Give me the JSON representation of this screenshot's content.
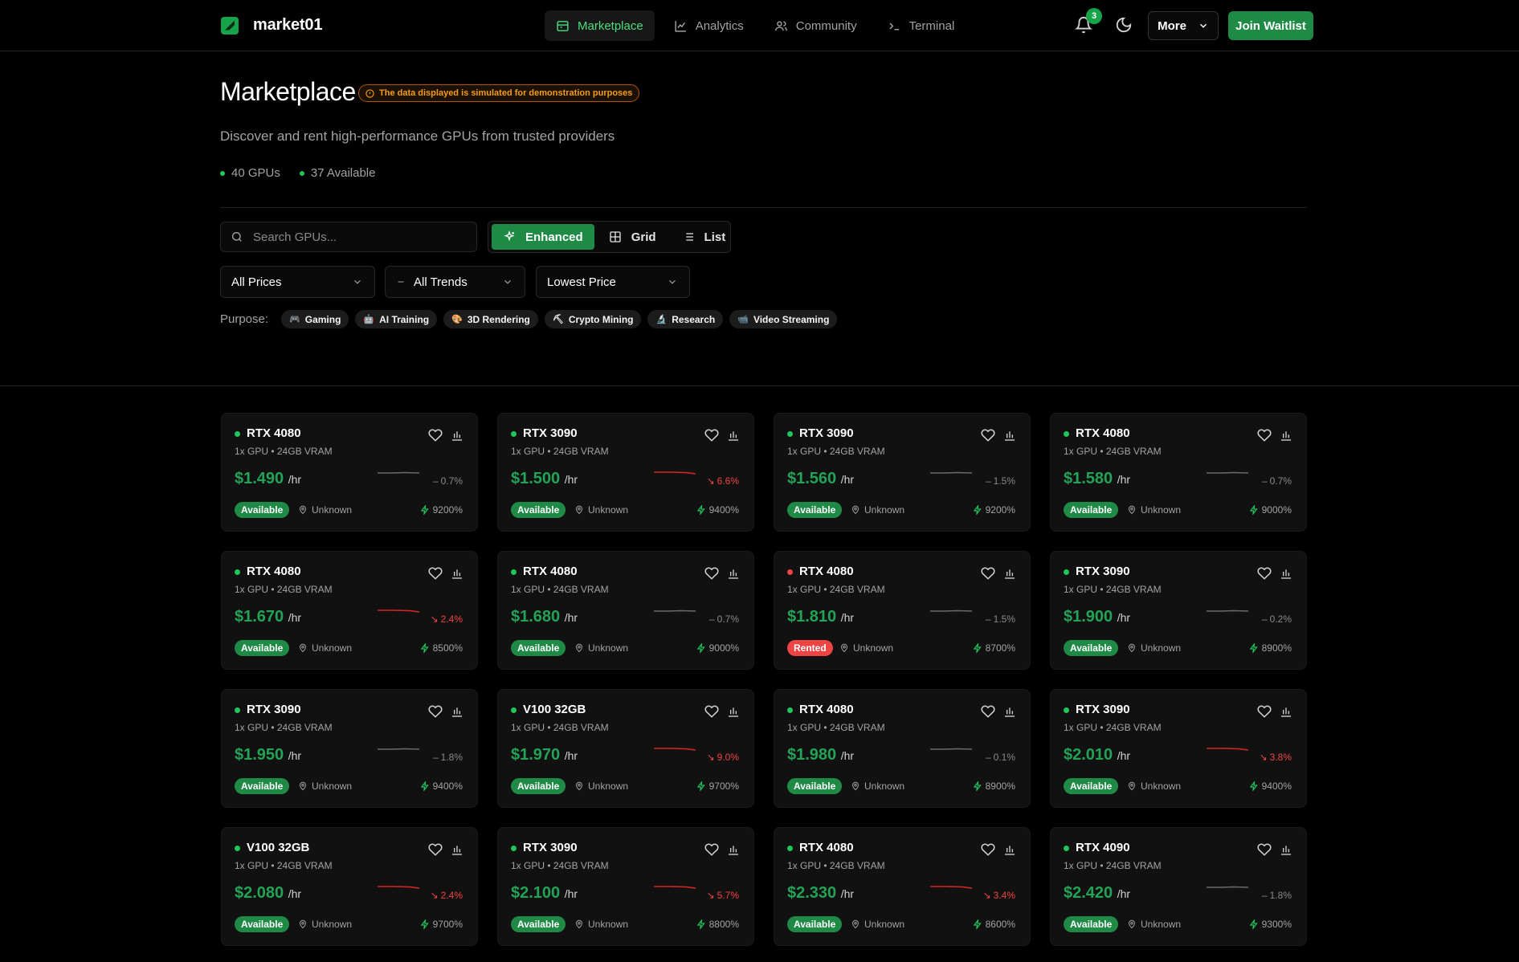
{
  "app": {
    "brand": "market01",
    "notification_count": "3",
    "more_label": "More",
    "join_label": "Join Waitlist"
  },
  "nav": [
    {
      "label": "Marketplace",
      "icon": "store-icon",
      "active": true
    },
    {
      "label": "Analytics",
      "icon": "chart-line-icon",
      "active": false
    },
    {
      "label": "Community",
      "icon": "users-icon",
      "active": false
    },
    {
      "label": "Terminal",
      "icon": "terminal-icon",
      "active": false
    }
  ],
  "hero": {
    "title": "Marketplace",
    "demo_notice": "The data displayed is simulated for demonstration purposes",
    "subtitle": "Discover and rent high-performance GPUs from trusted providers",
    "stats": [
      "40 GPUs",
      "37 Available"
    ]
  },
  "controls": {
    "search_placeholder": "Search GPUs...",
    "view_modes": [
      {
        "label": "Enhanced",
        "icon": "sparkles-icon",
        "active": true
      },
      {
        "label": "Grid",
        "icon": "grid-icon",
        "active": false
      },
      {
        "label": "List",
        "icon": "list-icon",
        "active": false
      }
    ],
    "price_filter": "All Prices",
    "trend_filter": "All Trends",
    "sort": "Lowest Price",
    "purpose_label": "Purpose:",
    "purposes": [
      {
        "label": "Gaming",
        "icon": "🎮"
      },
      {
        "label": "AI Training",
        "icon": "🤖"
      },
      {
        "label": "3D Rendering",
        "icon": "🎨"
      },
      {
        "label": "Crypto Mining",
        "icon": "⛏"
      },
      {
        "label": "Research",
        "icon": "🔬"
      },
      {
        "label": "Video Streaming",
        "icon": "📹"
      }
    ]
  },
  "colors": {
    "accent": "#1f8a45",
    "price_green": "#22a355",
    "down_red": "#ef4444",
    "warning": "#f59e0b"
  },
  "gpus": [
    {
      "name": "RTX 4080",
      "spec": "1x GPU • 24GB VRAM",
      "price": "$1.490",
      "unit": "/hr",
      "trend": "0.7%",
      "dir": "flat",
      "status": "Available",
      "location": "Unknown",
      "score": "9200%"
    },
    {
      "name": "RTX 3090",
      "spec": "1x GPU • 24GB VRAM",
      "price": "$1.500",
      "unit": "/hr",
      "trend": "6.6%",
      "dir": "down",
      "status": "Available",
      "location": "Unknown",
      "score": "9400%"
    },
    {
      "name": "RTX 3090",
      "spec": "1x GPU • 24GB VRAM",
      "price": "$1.560",
      "unit": "/hr",
      "trend": "1.5%",
      "dir": "flat",
      "status": "Available",
      "location": "Unknown",
      "score": "9200%"
    },
    {
      "name": "RTX 4080",
      "spec": "1x GPU • 24GB VRAM",
      "price": "$1.580",
      "unit": "/hr",
      "trend": "0.7%",
      "dir": "flat",
      "status": "Available",
      "location": "Unknown",
      "score": "9000%"
    },
    {
      "name": "RTX 4080",
      "spec": "1x GPU • 24GB VRAM",
      "price": "$1.670",
      "unit": "/hr",
      "trend": "2.4%",
      "dir": "down",
      "status": "Available",
      "location": "Unknown",
      "score": "8500%"
    },
    {
      "name": "RTX 4080",
      "spec": "1x GPU • 24GB VRAM",
      "price": "$1.680",
      "unit": "/hr",
      "trend": "0.7%",
      "dir": "flat",
      "status": "Available",
      "location": "Unknown",
      "score": "9000%"
    },
    {
      "name": "RTX 4080",
      "spec": "1x GPU • 24GB VRAM",
      "price": "$1.810",
      "unit": "/hr",
      "trend": "1.5%",
      "dir": "flat",
      "status": "Rented",
      "location": "Unknown",
      "score": "8700%"
    },
    {
      "name": "RTX 3090",
      "spec": "1x GPU • 24GB VRAM",
      "price": "$1.900",
      "unit": "/hr",
      "trend": "0.2%",
      "dir": "flat",
      "status": "Available",
      "location": "Unknown",
      "score": "8900%"
    },
    {
      "name": "RTX 3090",
      "spec": "1x GPU • 24GB VRAM",
      "price": "$1.950",
      "unit": "/hr",
      "trend": "1.8%",
      "dir": "flat",
      "status": "Available",
      "location": "Unknown",
      "score": "9400%"
    },
    {
      "name": "V100 32GB",
      "spec": "1x GPU • 24GB VRAM",
      "price": "$1.970",
      "unit": "/hr",
      "trend": "9.0%",
      "dir": "down",
      "status": "Available",
      "location": "Unknown",
      "score": "9700%"
    },
    {
      "name": "RTX 4080",
      "spec": "1x GPU • 24GB VRAM",
      "price": "$1.980",
      "unit": "/hr",
      "trend": "0.1%",
      "dir": "flat",
      "status": "Available",
      "location": "Unknown",
      "score": "8900%"
    },
    {
      "name": "RTX 3090",
      "spec": "1x GPU • 24GB VRAM",
      "price": "$2.010",
      "unit": "/hr",
      "trend": "3.8%",
      "dir": "down",
      "status": "Available",
      "location": "Unknown",
      "score": "9400%"
    },
    {
      "name": "V100 32GB",
      "spec": "1x GPU • 24GB VRAM",
      "price": "$2.080",
      "unit": "/hr",
      "trend": "2.4%",
      "dir": "down",
      "status": "Available",
      "location": "Unknown",
      "score": "9700%"
    },
    {
      "name": "RTX 3090",
      "spec": "1x GPU • 24GB VRAM",
      "price": "$2.100",
      "unit": "/hr",
      "trend": "5.7%",
      "dir": "down",
      "status": "Available",
      "location": "Unknown",
      "score": "8800%"
    },
    {
      "name": "RTX 4080",
      "spec": "1x GPU • 24GB VRAM",
      "price": "$2.330",
      "unit": "/hr",
      "trend": "3.4%",
      "dir": "down",
      "status": "Available",
      "location": "Unknown",
      "score": "8600%"
    },
    {
      "name": "RTX 4090",
      "spec": "1x GPU • 24GB VRAM",
      "price": "$2.420",
      "unit": "/hr",
      "trend": "1.8%",
      "dir": "flat",
      "status": "Available",
      "location": "Unknown",
      "score": "9300%"
    }
  ]
}
